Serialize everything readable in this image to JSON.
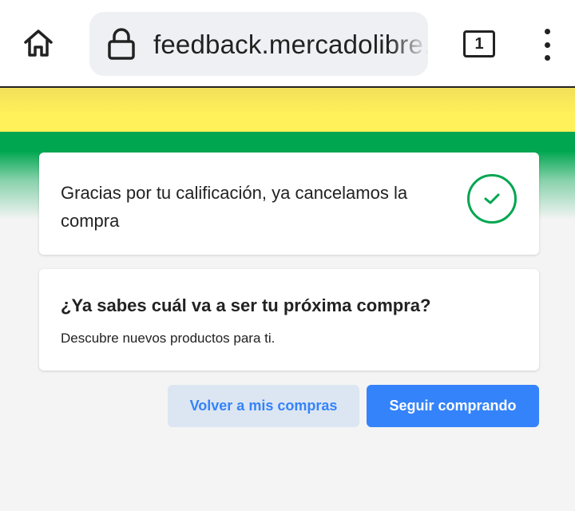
{
  "browser": {
    "url": "feedback.mercadolibre.com",
    "tab_count": "1",
    "icons": {
      "home": "home-icon",
      "lock": "lock-icon",
      "tabs": "tabs-icon",
      "menu": "more-vert-icon"
    }
  },
  "colors": {
    "yellow": "#fff159",
    "green": "#00a650",
    "blue": "#3483fa",
    "secondary_bg": "#dce6f2",
    "page_bg": "#f4f4f4"
  },
  "confirmation": {
    "message": "Gracias por tu calificación, ya cancelamos la compra",
    "icon": "check-circle-icon"
  },
  "promo": {
    "title": "¿Ya sabes cuál va a ser tu próxima compra?",
    "subtitle": "Descubre nuevos productos para ti."
  },
  "actions": {
    "back_label": "Volver a mis compras",
    "continue_label": "Seguir comprando"
  }
}
